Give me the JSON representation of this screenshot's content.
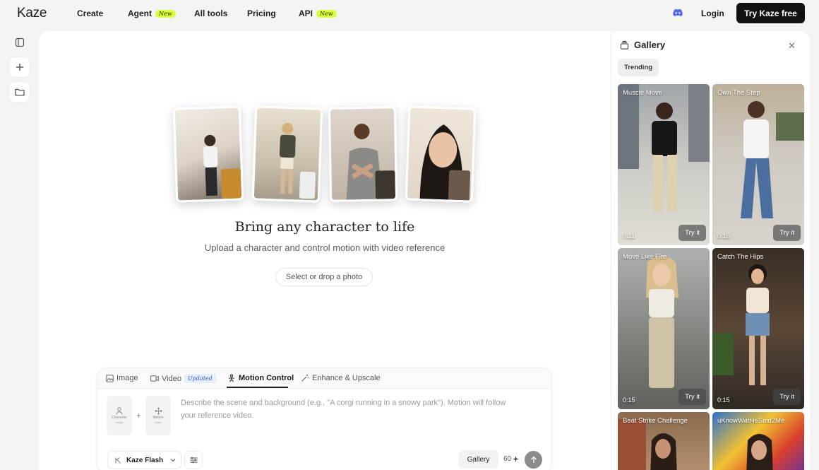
{
  "nav": {
    "logo": "Kaze",
    "items": [
      {
        "label": "Create"
      },
      {
        "label": "Agent",
        "badge": "New"
      },
      {
        "label": "All tools"
      },
      {
        "label": "Pricing"
      },
      {
        "label": "API",
        "badge": "New"
      }
    ],
    "login": "Login",
    "cta": "Try Kaze free"
  },
  "hero": {
    "title": "Bring any character to life",
    "subtitle": "Upload a character and control motion with video reference",
    "select_button": "Select or drop a photo"
  },
  "composer": {
    "tabs": [
      {
        "label": "Image",
        "icon": "image-icon"
      },
      {
        "label": "Video",
        "icon": "video-icon",
        "badge": "Updated"
      },
      {
        "label": "Motion Control",
        "icon": "motion-icon",
        "active": true
      },
      {
        "label": "Enhance & Upscale",
        "icon": "wand-icon"
      }
    ],
    "slots": [
      {
        "label": "Character",
        "sub": "Image"
      },
      {
        "label": "Motion",
        "sub": "Video"
      }
    ],
    "placeholder": "Describe the scene and background (e.g., \"A corgi running in a snowy park\"). Motion will follow your reference video.",
    "model": "Kaze Flash",
    "gallery_button": "Gallery",
    "credits": "60"
  },
  "gallery": {
    "title": "Gallery",
    "filter": "Trending",
    "cards": [
      {
        "title": "Muscle Move",
        "duration": "0:11",
        "action": "Try it"
      },
      {
        "title": "Own The Step",
        "duration": "0:15",
        "action": "Try it"
      },
      {
        "title": "Move Like Fire",
        "duration": "0:15",
        "action": "Try it"
      },
      {
        "title": "Catch The Hips",
        "duration": "0:15",
        "action": "Try it"
      },
      {
        "title": "Beat Strike Challenge",
        "duration": "",
        "action": ""
      },
      {
        "title": "uKnowWatHeSaid2Me",
        "duration": "",
        "action": ""
      }
    ]
  },
  "colors": {
    "accent_badge": "#d9ff3f",
    "cta_bg": "#111111",
    "discord": "#5865f2"
  }
}
